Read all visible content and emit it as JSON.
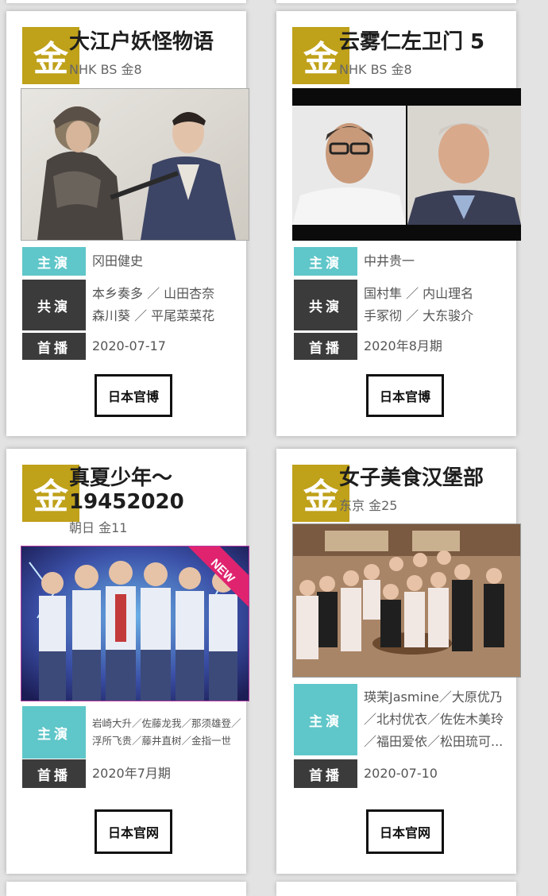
{
  "cards": [
    {
      "badge": "金",
      "title": "大江户妖怪物语",
      "channel": "NHK BS 金8",
      "lead_label": "主演",
      "lead": "冈田健史",
      "costar_label": "共演",
      "costar_lines": [
        "本乡奏多 ／ 山田杏奈",
        "森川葵 ／ 平尾菜菜花"
      ],
      "air_label": "首播",
      "air": "2020-07-17",
      "link": "日本官博"
    },
    {
      "badge": "金",
      "title": "云雾仁左卫门 5",
      "channel": "NHK BS 金8",
      "lead_label": "主演",
      "lead": "中井贵一",
      "costar_label": "共演",
      "costar_lines": [
        "国村隼 ／ 内山理名",
        "手冢彻 ／ 大东骏介"
      ],
      "air_label": "首播",
      "air": "2020年8月期",
      "link": "日本官博"
    },
    {
      "badge": "金",
      "title_lines": [
        "真夏少年～",
        "19452020"
      ],
      "channel": "朝日 金11",
      "new_tag": "NEW",
      "lead_label": "主演",
      "lead_lines": [
        "岩崎大升／佐藤龙我／那须雄登／",
        "浮所飞贵／藤井直树／金指一世"
      ],
      "air_label": "首播",
      "air": "2020年7月期",
      "link": "日本官网"
    },
    {
      "badge": "金",
      "title": "女子美食汉堡部",
      "channel": "东京 金25",
      "lead_label": "主演",
      "lead_lines": [
        "瑛茉Jasmine／大原优乃",
        "／北村优衣／佐佐木美玲",
        "／福田爱依／松田琉可..."
      ],
      "air_label": "首播",
      "air": "2020-07-10",
      "link": "日本官网"
    }
  ]
}
